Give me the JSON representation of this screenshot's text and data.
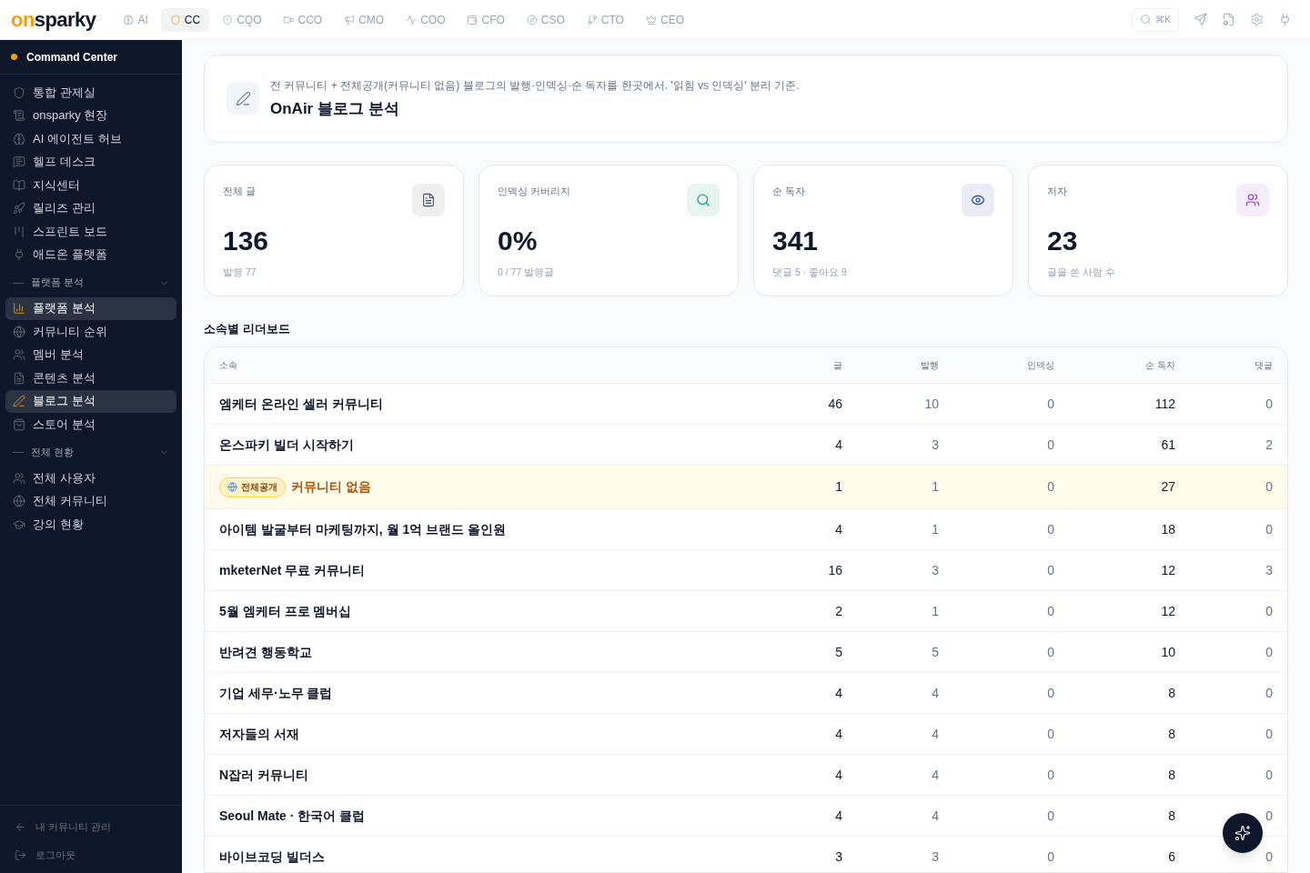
{
  "topbar": {
    "logo": {
      "part_1": "on",
      "part_2": "sparky"
    },
    "tabs": [
      {
        "label": "AI",
        "selected": false
      },
      {
        "label": "CC",
        "selected": true
      },
      {
        "label": "CQO",
        "selected": false
      },
      {
        "label": "CCO",
        "selected": false
      },
      {
        "label": "CMO",
        "selected": false
      },
      {
        "label": "COO",
        "selected": false
      },
      {
        "label": "CFO",
        "selected": false
      },
      {
        "label": "CSO",
        "selected": false
      },
      {
        "label": "CTO",
        "selected": false
      },
      {
        "label": "CEO",
        "selected": false
      }
    ],
    "search_shortcut": "⌘K"
  },
  "sidebar": {
    "title": "Command Center",
    "items": [
      {
        "label": "통합 관제실",
        "selected": false
      },
      {
        "label": "onsparky 현장",
        "selected": false
      },
      {
        "label": "AI 에이전트 허브",
        "selected": false
      },
      {
        "label": "헬프 데스크",
        "selected": false
      },
      {
        "label": "지식센터",
        "selected": false
      },
      {
        "label": "릴리즈 관리",
        "selected": false
      },
      {
        "label": "스프린트 보드",
        "selected": false
      },
      {
        "label": "애드온 플랫폼",
        "selected": false
      }
    ],
    "sections": [
      {
        "title": "플랫폼 분석",
        "expanded": true,
        "items": [
          {
            "label": "플랫폼 분석",
            "selected": true
          },
          {
            "label": "커뮤니티 순위",
            "selected": false
          },
          {
            "label": "멤버 분석",
            "selected": false
          },
          {
            "label": "콘텐츠 분석",
            "selected": false
          },
          {
            "label": "블로그 분석",
            "selected": true
          },
          {
            "label": "스토어 분석",
            "selected": false
          }
        ]
      },
      {
        "title": "전체 현황",
        "expanded": true,
        "items": [
          {
            "label": "전체 사용자",
            "selected": false
          },
          {
            "label": "전체 커뮤니티",
            "selected": false
          },
          {
            "label": "강의 현황",
            "selected": false
          }
        ]
      }
    ],
    "footer": [
      {
        "label": "내 커뮤니티 관리"
      },
      {
        "label": "로그아웃"
      }
    ]
  },
  "page": {
    "description": "전 커뮤니티 + 전체공개(커뮤니티 없음) 블로그의 발행·인덱싱·순 독자를 한곳에서. '읽힘 vs 인덱싱' 분리 기준.",
    "title": "OnAir 블로그 분석"
  },
  "stats": [
    {
      "label": "전체 글",
      "value": "136",
      "sub": "발행 77",
      "color": "#475569"
    },
    {
      "label": "인덱싱 커버리지",
      "value": "0%",
      "sub": "0 / 77 발행글",
      "color": "#059669"
    },
    {
      "label": "순 독자",
      "value": "341",
      "sub": "댓글 5 · 좋아요 9",
      "color": "#1e40af"
    },
    {
      "label": "저자",
      "value": "23",
      "sub": "글을 쓴 사람 수",
      "color": "#9333ea"
    }
  ],
  "leaderboard": {
    "title": "소속별 리더보드",
    "columns": [
      "소속",
      "글",
      "발행",
      "인덱싱",
      "순 독자",
      "댓글"
    ],
    "rows": [
      {
        "kind": "community",
        "cells": [
          "엠케터 온라인 셀러 커뮤니티",
          "46",
          "10",
          "0",
          "112",
          "0"
        ]
      },
      {
        "kind": "community",
        "cells": [
          "온스파키 빌더 시작하기",
          "4",
          "3",
          "0",
          "61",
          "2"
        ]
      },
      {
        "kind": "public",
        "badge": "전체공개",
        "cells": [
          "커뮤니티 없음",
          "1",
          "1",
          "0",
          "27",
          "0"
        ]
      },
      {
        "kind": "community",
        "cells": [
          "아이템 발굴부터 마케팅까지, 월 1억 브랜드 올인원",
          "4",
          "1",
          "0",
          "18",
          "0"
        ]
      },
      {
        "kind": "community",
        "cells": [
          "mketerNet 무료 커뮤니티",
          "16",
          "3",
          "0",
          "12",
          "3"
        ]
      },
      {
        "kind": "community",
        "cells": [
          "5월 엠케터 프로 멤버십",
          "2",
          "1",
          "0",
          "12",
          "0"
        ]
      },
      {
        "kind": "community",
        "cells": [
          "반려견 행동학교",
          "5",
          "5",
          "0",
          "10",
          "0"
        ]
      },
      {
        "kind": "community",
        "cells": [
          "기업 세무·노무 클럽",
          "4",
          "4",
          "0",
          "8",
          "0"
        ]
      },
      {
        "kind": "community",
        "cells": [
          "저자들의 서재",
          "4",
          "4",
          "0",
          "8",
          "0"
        ]
      },
      {
        "kind": "community",
        "cells": [
          "N잡러 커뮤니티",
          "4",
          "4",
          "0",
          "8",
          "0"
        ]
      },
      {
        "kind": "community",
        "cells": [
          "Seoul Mate · 한국어 클럽",
          "4",
          "4",
          "0",
          "8",
          "0"
        ]
      },
      {
        "kind": "community",
        "cells": [
          "바이브코딩 빌더스",
          "3",
          "3",
          "0",
          "6",
          "0"
        ]
      }
    ]
  }
}
